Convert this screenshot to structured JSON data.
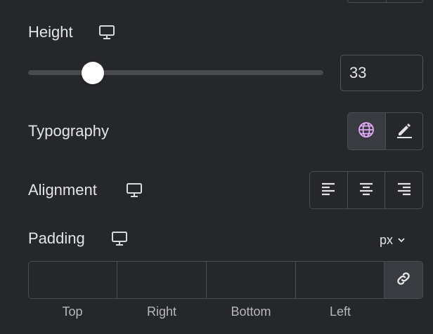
{
  "height": {
    "label": "Height",
    "device_icon": "desktop-icon",
    "value": "33",
    "slider_value": 33,
    "slider_max": 150
  },
  "typography": {
    "label": "Typography",
    "buttons": [
      {
        "icon": "globe-icon",
        "active": true
      },
      {
        "icon": "pencil-icon",
        "active": false
      }
    ]
  },
  "alignment": {
    "label": "Alignment",
    "device_icon": "desktop-icon",
    "options": [
      {
        "icon": "align-left-icon"
      },
      {
        "icon": "align-center-icon"
      },
      {
        "icon": "align-right-icon"
      }
    ]
  },
  "padding": {
    "label": "Padding",
    "device_icon": "desktop-icon",
    "unit": "px",
    "fields": [
      {
        "label": "Top",
        "value": ""
      },
      {
        "label": "Right",
        "value": ""
      },
      {
        "label": "Bottom",
        "value": ""
      },
      {
        "label": "Left",
        "value": ""
      }
    ],
    "link_icon": "link-icon"
  },
  "colors": {
    "background": "#26272b",
    "border": "#4c4d52",
    "active_button": "#3a3b41",
    "globe_accent": "#e2a8f5",
    "text": "#e3e4e6"
  }
}
